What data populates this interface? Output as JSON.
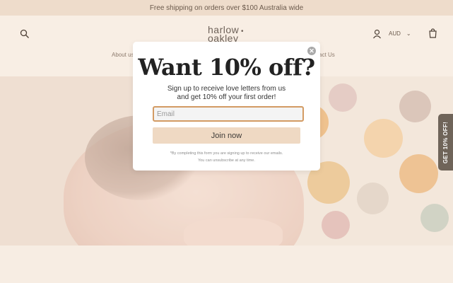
{
  "announcement": "Free shipping on orders over $100 Australia wide",
  "header": {
    "logo_line1": "harlow",
    "logo_line2": "oakley",
    "logo_dot": "•",
    "currency": "AUD",
    "currency_chevron": "⌄",
    "nav_left": "About us",
    "nav_right": "ontact Us"
  },
  "popup": {
    "close": "✕",
    "headline": "Want 10% off?",
    "subtext": "Sign up to receive love letters from us and get 10% off your first order!",
    "email_placeholder": "Email",
    "email_value": "",
    "join_label": "Join now",
    "disclaimer_line1": "*By completing this form you are signing up to receive our emails.",
    "disclaimer_line2": "You can unsubscribe at any time."
  },
  "side_tab": "GET 10% OFF!",
  "colors": {
    "accent": "#d39b63",
    "button": "#efd9c3",
    "background": "#f7ede3"
  }
}
